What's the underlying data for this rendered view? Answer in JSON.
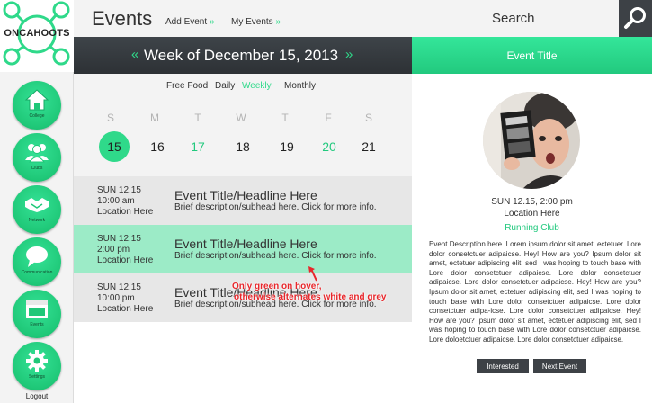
{
  "logo": {
    "text": "ONCAHOOTS"
  },
  "sidebar": {
    "items": [
      {
        "label": "College",
        "icon": "house-icon"
      },
      {
        "label": "Clubs",
        "icon": "people-icon"
      },
      {
        "label": "Network",
        "icon": "handshake-icon"
      },
      {
        "label": "Communication",
        "icon": "speech-bubble-icon"
      },
      {
        "label": "Events",
        "icon": "calendar-icon"
      },
      {
        "label": "Settings",
        "icon": "gear-icon"
      }
    ],
    "logout": "Logout"
  },
  "header": {
    "title": "Events",
    "links": [
      {
        "label": "Add Event",
        "arrow": "»"
      },
      {
        "label": "My Events",
        "arrow": "»"
      }
    ]
  },
  "search": {
    "placeholder": "Search",
    "icon": "search-icon"
  },
  "week": {
    "prev": "«",
    "title": "Week of December 15, 2013",
    "next": "»"
  },
  "filters": [
    {
      "label": "Free Food",
      "active": false
    },
    {
      "label": "Daily",
      "active": false
    },
    {
      "label": "Weekly",
      "active": true
    },
    {
      "label": "Monthly",
      "active": false
    }
  ],
  "calendar": {
    "days_of_week": [
      "S",
      "M",
      "T",
      "W",
      "T",
      "F",
      "S"
    ],
    "dates": [
      "15",
      "16",
      "17",
      "18",
      "19",
      "20",
      "21"
    ],
    "selected": "15"
  },
  "events": [
    {
      "date": "SUN 12.15",
      "time": "10:00 am",
      "location": "Location Here",
      "title": "Event Title/Headline Here",
      "desc": "Brief description/subhead here. Click for more info."
    },
    {
      "date": "SUN 12.15",
      "time": "2:00 pm",
      "location": "Location Here",
      "title": "Event Title/Headline Here",
      "desc": "Brief description/subhead here. Click for more info."
    },
    {
      "date": "SUN 12.15",
      "time": "10:00 pm",
      "location": "Location Here",
      "title": "Event Title/Headline Here",
      "desc": "Brief description/subhead here. Click for more info."
    }
  ],
  "annotation": {
    "line1": "Only green on hover,",
    "line2": "otherwise alternates white and grey"
  },
  "detail": {
    "title": "Event Title",
    "datetime": "SUN 12.15, 2:00 pm",
    "location": "Location Here",
    "organizer": "Running Club",
    "description": "Event Description here. Lorem ipsum dolor sit amet, ectetuer. Lore dolor consetctuer adipaicse. Hey! How are you? Ipsum dolor sit amet, ectetuer adipiscing elit, sed I was hoping to touch base with Lore dolor consetctuer adipaicse. Lore dolor consetctuer adipaicse. Lore dolor consetctuer adipaicse. Hey! How are you? Ipsum dolor sit amet, ectetuer adipiscing elit, sed I was hoping to touch base with Lore dolor consetctuer adipaicse. Lore dolor consetctuer adipa-icse. Lore dolor consetctuer adipaicse. Hey! How are you? Ipsum dolor sit amet, ectetuer adipiscing elit, sed I was hoping to touch base with Lore dolor consetctuer adipaicse. Lore doloetctuer adipaicse. Lore dolor consetctuer adipaicse.",
    "buttons": {
      "interested": "Interested",
      "next": "Next Event"
    }
  },
  "colors": {
    "accent": "#2fd98a",
    "dark": "#3d4146",
    "hover_row": "#9cebc7",
    "grey_row": "#e7e7e7",
    "annotation": "#e8262b"
  }
}
